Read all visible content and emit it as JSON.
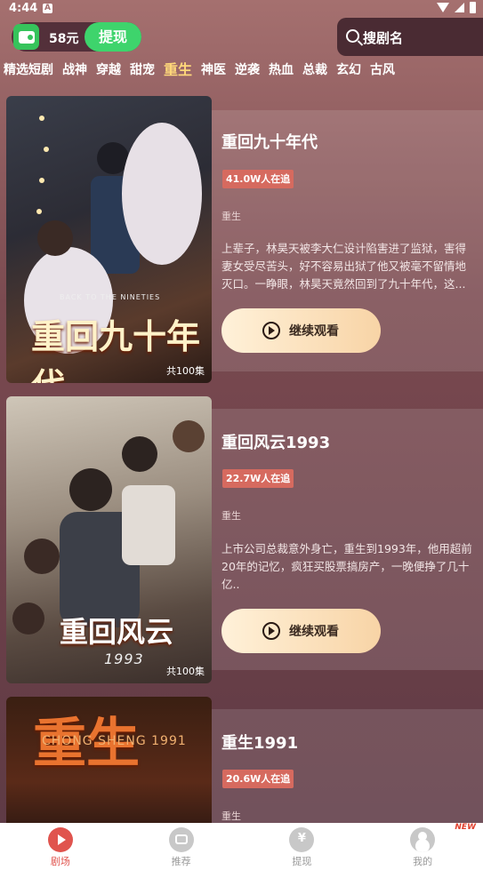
{
  "status_bar": {
    "time": "4:44",
    "notif_icon": "A"
  },
  "wallet": {
    "amount": "58元",
    "withdraw_label": "提现"
  },
  "search": {
    "placeholder": "搜剧名"
  },
  "tabs": [
    "精选短剧",
    "战神",
    "穿越",
    "甜宠",
    "重生",
    "神医",
    "逆袭",
    "热血",
    "总裁",
    "玄幻",
    "古风"
  ],
  "active_tab": "重生",
  "dramas": [
    {
      "title": "重回九十年代",
      "watching": "41.0W人在追",
      "genre": "重生",
      "desc": "上辈子，林昊天被李大仁设计陷害进了监狱，害得妻女受尽苦头，好不容易出狱了他又被毫不留情地灭口。一睁眼，林昊天竟然回到了九十年代，这...",
      "episodes": "共100集",
      "poster_title": "重回九十年代",
      "poster_subtitle": "BACK TO THE NINETIES",
      "watch_label": "继续观看"
    },
    {
      "title": "重回风云1993",
      "watching": "22.7W人在追",
      "genre": "重生",
      "desc": "上市公司总裁意外身亡，重生到1993年，他用超前20年的记忆，疯狂买股票搞房产，一晚便挣了几十亿..",
      "episodes": "共100集",
      "poster_title": "重回风云",
      "poster_subtitle": "1993",
      "watch_label": "继续观看"
    },
    {
      "title": "重生1991",
      "watching": "20.6W人在追",
      "genre": "重生",
      "poster_title": "重生",
      "poster_subtitle": "CHONG SHENG 1991"
    }
  ],
  "nav": [
    {
      "label": "剧场",
      "icon": "theater-icon",
      "active": true
    },
    {
      "label": "推荐",
      "icon": "recommend-icon",
      "active": false
    },
    {
      "label": "提现",
      "icon": "withdraw-icon",
      "active": false
    },
    {
      "label": "我的",
      "icon": "profile-icon",
      "active": false,
      "tag": "NEW"
    }
  ]
}
